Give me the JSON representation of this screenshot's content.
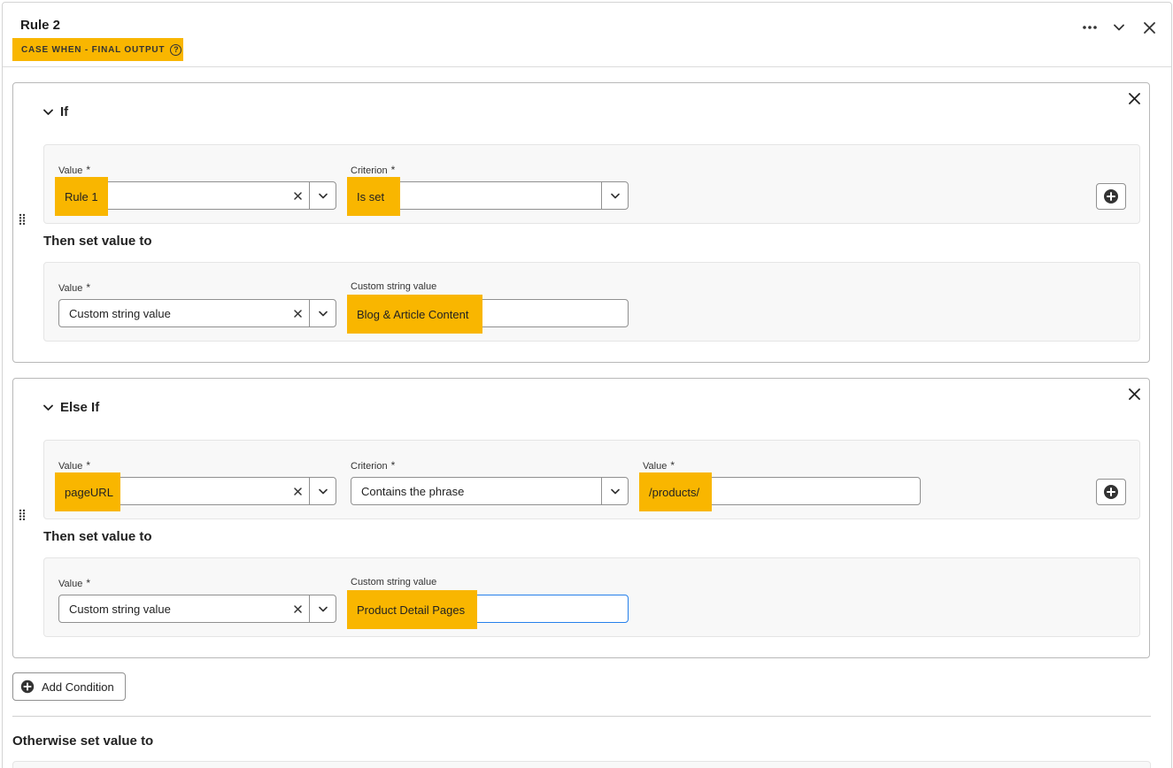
{
  "header": {
    "title": "Rule 2",
    "rule_type": "CASE WHEN - FINAL OUTPUT"
  },
  "if_block": {
    "label": "If",
    "condition": {
      "value_label": "Value",
      "value": "Rule 1",
      "criterion_label": "Criterion",
      "criterion": "Is set"
    },
    "then_label": "Then set value to",
    "output": {
      "value_label": "Value",
      "value": "Custom string value",
      "custom_label": "Custom string value",
      "custom_value": "Blog & Article Content"
    }
  },
  "else_if_block": {
    "label": "Else If",
    "condition": {
      "value_label": "Value",
      "value": "pageURL",
      "criterion_label": "Criterion",
      "criterion": "Contains the phrase",
      "match_label": "Value",
      "match_value": "/products/"
    },
    "then_label": "Then set value to",
    "output": {
      "value_label": "Value",
      "value": "Custom string value",
      "custom_label": "Custom string value",
      "custom_value": "Product Detail Pages"
    }
  },
  "footer": {
    "add_condition": "Add Condition",
    "otherwise_label": "Otherwise set value to"
  },
  "colors": {
    "highlight": "#f9b600",
    "focus_border": "#2680eb"
  },
  "icons": [
    "more-icon",
    "chevron-down-icon",
    "close-icon",
    "help-icon",
    "drag-handle-icon",
    "add-circle-icon",
    "clear-icon"
  ]
}
